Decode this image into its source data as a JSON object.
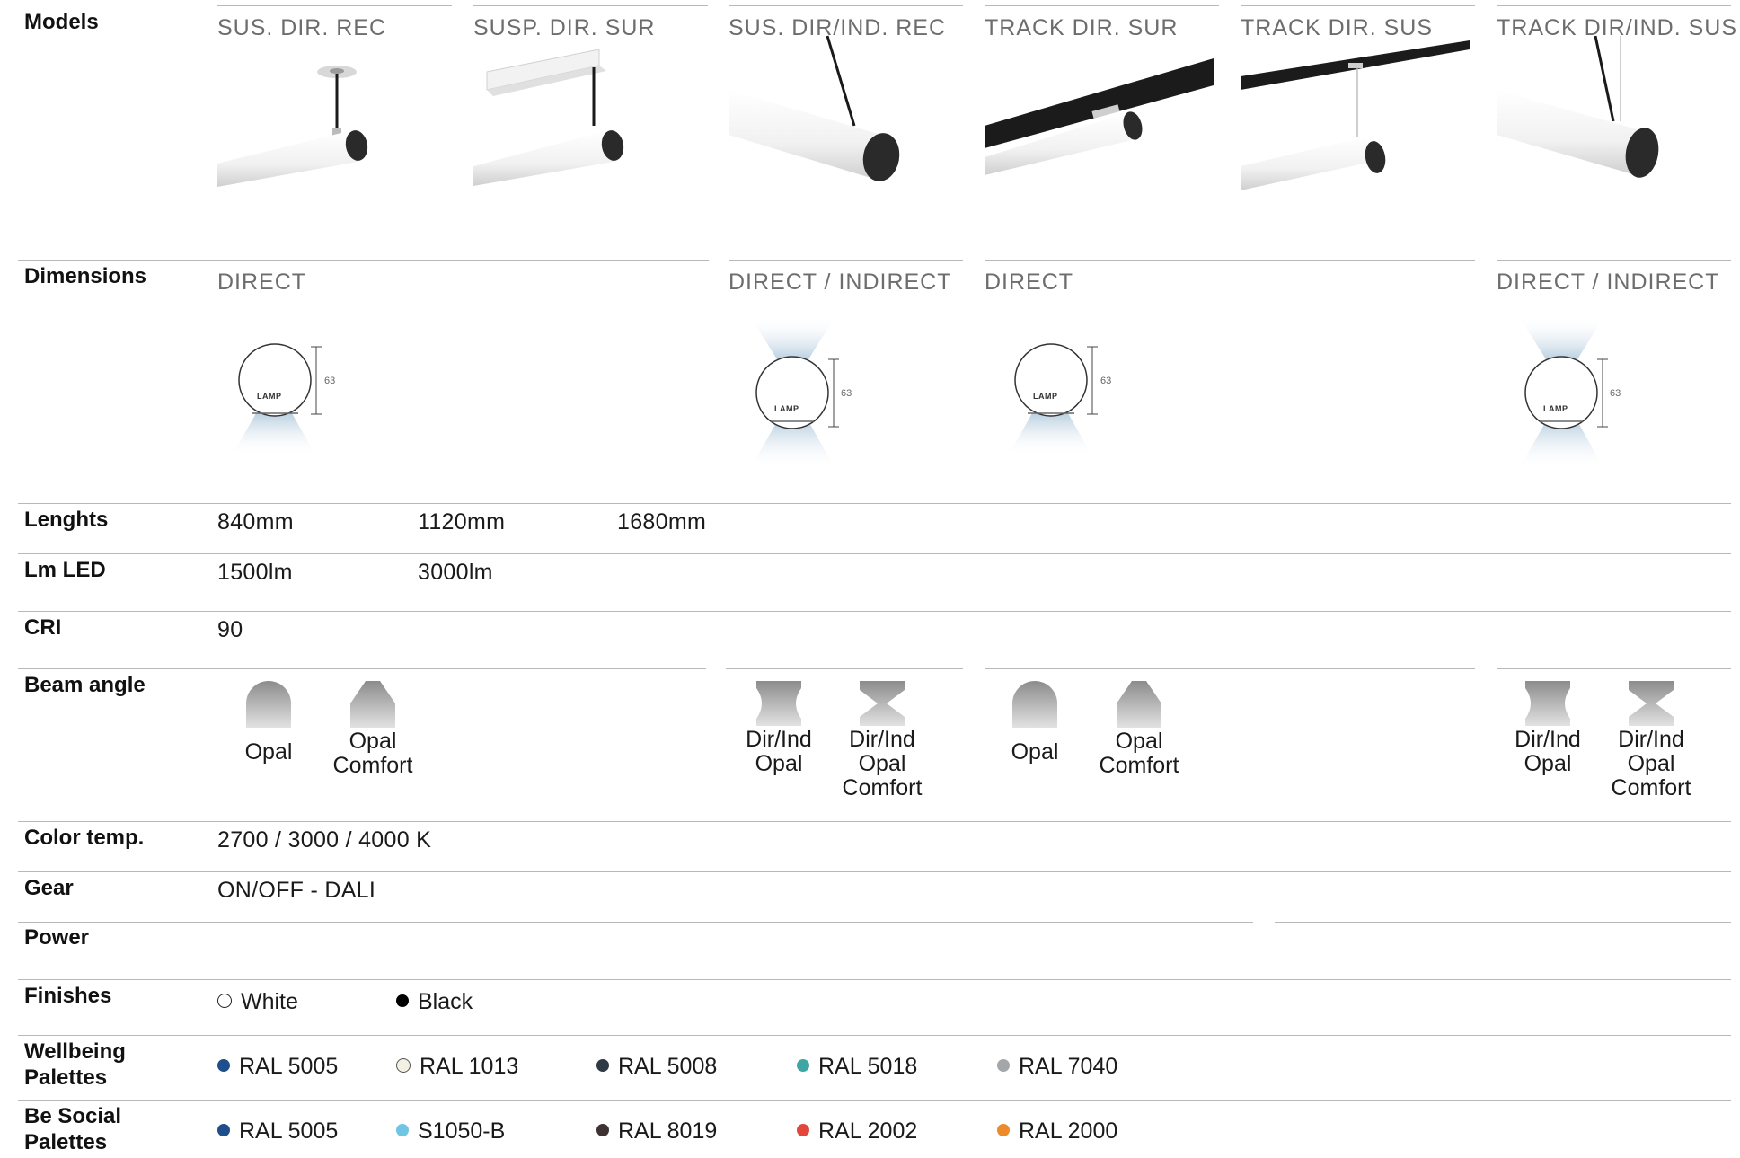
{
  "rows": {
    "models": "Models",
    "dimensions": "Dimensions",
    "lenghts": "Lenghts",
    "lm_led": "Lm LED",
    "cri": "CRI",
    "beam_angle": "Beam angle",
    "color_temp": "Color temp.",
    "gear": "Gear",
    "power": "Power",
    "finishes": "Finishes",
    "wellbeing_1": "Wellbeing",
    "wellbeing_2": "Palettes",
    "social_1": "Be Social",
    "social_2": "Palettes"
  },
  "models": [
    {
      "title": "SUS. DIR. REC"
    },
    {
      "title": "SUSP. DIR. SUR"
    },
    {
      "title": "SUS. DIR/IND. REC"
    },
    {
      "title": "TRACK DIR. SUR"
    },
    {
      "title": "TRACK DIR. SUS"
    },
    {
      "title": "TRACK DIR/IND. SUS"
    }
  ],
  "dimensions": {
    "groups": [
      "DIRECT",
      "DIRECT / INDIRECT",
      "DIRECT",
      "DIRECT / INDIRECT"
    ],
    "diagram_brand": "LAMP",
    "diagram_size": "63"
  },
  "lengths": [
    "840mm",
    "1120mm",
    "1680mm"
  ],
  "lm_led": [
    "1500lm",
    "3000lm"
  ],
  "cri": "90",
  "beam": {
    "opal": "Opal",
    "opal_comfort_1": "Opal",
    "opal_comfort_2": "Comfort",
    "dirind_1": "Dir/Ind",
    "dirind_2": "Opal",
    "dirind_comfort_3": "Comfort"
  },
  "color_temp": "2700 / 3000 / 4000 K",
  "gear": "ON/OFF - DALI",
  "finishes": [
    {
      "label": "White",
      "color": "#ffffff",
      "outline": true
    },
    {
      "label": "Black",
      "color": "#000000",
      "outline": false
    }
  ],
  "wellbeing": [
    {
      "label": "RAL 5005",
      "color": "#1f4e8c"
    },
    {
      "label": "RAL 1013",
      "color": "#f3efe1"
    },
    {
      "label": "RAL 5008",
      "color": "#2f3a44"
    },
    {
      "label": "RAL 5018",
      "color": "#3fa6a3"
    },
    {
      "label": "RAL 7040",
      "color": "#a3a7aa"
    }
  ],
  "social": [
    {
      "label": "RAL 5005",
      "color": "#1f4e8c"
    },
    {
      "label": "S1050-B",
      "color": "#6fc5e3"
    },
    {
      "label": "RAL 8019",
      "color": "#3e3233"
    },
    {
      "label": "RAL 2002",
      "color": "#e3473b"
    },
    {
      "label": "RAL 2000",
      "color": "#ee8a2a"
    }
  ]
}
